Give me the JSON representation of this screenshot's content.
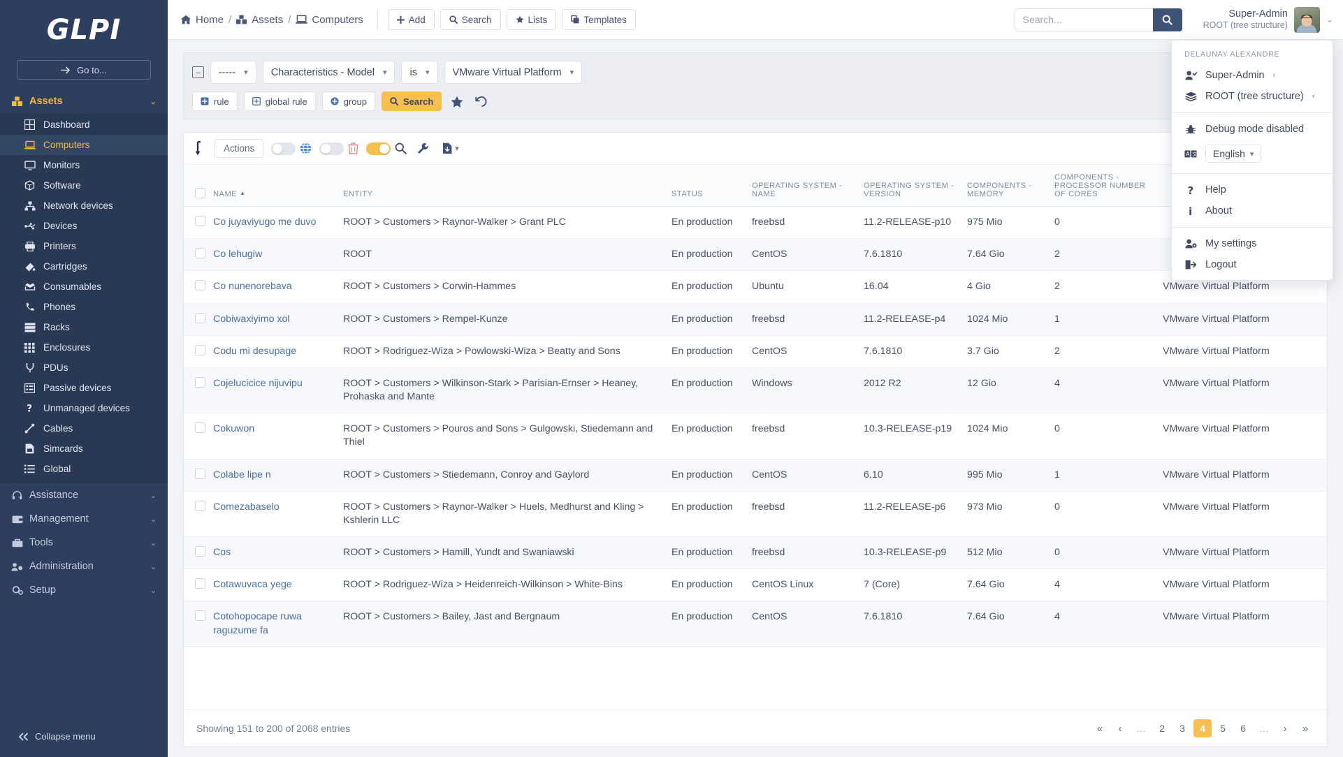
{
  "brand": {
    "logo": "GLPI",
    "goto_label": "Go to...",
    "collapse_label": "Collapse menu"
  },
  "sidebar": {
    "sections": [
      {
        "label": "Assets",
        "icon": "boxes-icon",
        "active": true
      },
      {
        "label": "Assistance",
        "icon": "headset-icon",
        "active": false
      },
      {
        "label": "Management",
        "icon": "wallet-icon",
        "active": false
      },
      {
        "label": "Tools",
        "icon": "toolbox-icon",
        "active": false
      },
      {
        "label": "Administration",
        "icon": "users-cog-icon",
        "active": false
      },
      {
        "label": "Setup",
        "icon": "cogs-icon",
        "active": false
      }
    ],
    "items": [
      {
        "label": "Dashboard",
        "icon": "grid-icon",
        "selected": false
      },
      {
        "label": "Computers",
        "icon": "laptop-icon",
        "selected": true
      },
      {
        "label": "Monitors",
        "icon": "monitor-icon",
        "selected": false
      },
      {
        "label": "Software",
        "icon": "cube-icon",
        "selected": false
      },
      {
        "label": "Network devices",
        "icon": "network-icon",
        "selected": false
      },
      {
        "label": "Devices",
        "icon": "usb-icon",
        "selected": false
      },
      {
        "label": "Printers",
        "icon": "printer-icon",
        "selected": false
      },
      {
        "label": "Cartridges",
        "icon": "cartridge-icon",
        "selected": false
      },
      {
        "label": "Consumables",
        "icon": "box-open-icon",
        "selected": false
      },
      {
        "label": "Phones",
        "icon": "phone-icon",
        "selected": false
      },
      {
        "label": "Racks",
        "icon": "server-icon",
        "selected": false
      },
      {
        "label": "Enclosures",
        "icon": "th-icon",
        "selected": false
      },
      {
        "label": "PDUs",
        "icon": "plug-icon",
        "selected": false
      },
      {
        "label": "Passive devices",
        "icon": "list-alt-icon",
        "selected": false
      },
      {
        "label": "Unmanaged devices",
        "icon": "question-icon",
        "selected": false
      },
      {
        "label": "Cables",
        "icon": "cable-icon",
        "selected": false
      },
      {
        "label": "Simcards",
        "icon": "simcard-icon",
        "selected": false
      },
      {
        "label": "Global",
        "icon": "list-icon",
        "selected": false
      }
    ]
  },
  "topbar": {
    "breadcrumb": [
      {
        "label": "Home",
        "icon": "home-icon"
      },
      {
        "label": "Assets",
        "icon": "boxes-icon"
      },
      {
        "label": "Computers",
        "icon": "laptop-icon"
      }
    ],
    "buttons": [
      {
        "label": "Add",
        "icon": "plus-icon"
      },
      {
        "label": "Search",
        "icon": "search-icon"
      },
      {
        "label": "Lists",
        "icon": "star-icon"
      },
      {
        "label": "Templates",
        "icon": "clone-icon"
      }
    ],
    "search_placeholder": "Search...",
    "user": {
      "name": "Super-Admin",
      "entity": "ROOT (tree structure)"
    }
  },
  "user_menu": {
    "header": "DELAUNAY ALEXANDRE",
    "profile": {
      "label": "Super-Admin",
      "icon": "user-check-icon",
      "arrow": "‹"
    },
    "entity": {
      "label": "ROOT (tree structure)",
      "icon": "layers-icon",
      "arrow": "‹"
    },
    "debug": {
      "label": "Debug mode disabled",
      "icon": "bug-icon"
    },
    "language": {
      "label": "English",
      "icon": "translate-icon"
    },
    "help": {
      "label": "Help",
      "icon": "question-icon"
    },
    "about": {
      "label": "About",
      "icon": "info-icon"
    },
    "settings": {
      "label": "My settings",
      "icon": "user-cog-icon"
    },
    "logout": {
      "label": "Logout",
      "icon": "signout-icon"
    }
  },
  "search_panel": {
    "logic": "-----",
    "field": "Characteristics - Model",
    "operator": "is",
    "value": "VMware Virtual Platform",
    "buttons": {
      "rule": "rule",
      "global_rule": "global rule",
      "group": "group",
      "search": "Search"
    },
    "star_icon": "star-icon",
    "reset_icon": "undo-icon"
  },
  "toolbar": {
    "actions_label": "Actions",
    "toggles": [
      {
        "name": "global-toggle",
        "icon": "globe-icon",
        "on": false
      },
      {
        "name": "delete-toggle",
        "icon": "trash-icon",
        "on": false
      },
      {
        "name": "search-toggle",
        "icon": "search-icon",
        "on": true
      }
    ],
    "wrench_icon": "wrench-icon",
    "export_icon": "file-export-icon"
  },
  "table": {
    "columns": [
      "NAME",
      "ENTITY",
      "STATUS",
      "OPERATING SYSTEM - NAME",
      "OPERATING SYSTEM - VERSION",
      "COMPONENTS - MEMORY",
      "COMPONENTS - PROCESSOR NUMBER OF CORES",
      ""
    ],
    "sort_column": "NAME",
    "sort_dir": "asc",
    "rows": [
      {
        "name": "Co juyaviyugo me duvo",
        "entity": "ROOT > Customers > Raynor-Walker > Grant PLC",
        "status": "En production",
        "os": "freebsd",
        "version": "11.2-RELEASE-p10",
        "memory": "975 Mio",
        "cores": "0",
        "model": ""
      },
      {
        "name": "Co lehugiw",
        "entity": "ROOT",
        "status": "En production",
        "os": "CentOS",
        "version": "7.6.1810",
        "memory": "7.64 Gio",
        "cores": "2",
        "model": ""
      },
      {
        "name": "Co nunenorebava",
        "entity": "ROOT > Customers > Corwin-Hammes",
        "status": "En production",
        "os": "Ubuntu",
        "version": "16.04",
        "memory": "4 Gio",
        "cores": "2",
        "model": "VMware Virtual Platform"
      },
      {
        "name": "Cobiwaxiyimo xol",
        "entity": "ROOT > Customers > Rempel-Kunze",
        "status": "En production",
        "os": "freebsd",
        "version": "11.2-RELEASE-p4",
        "memory": "1024 Mio",
        "cores": "1",
        "model": "VMware Virtual Platform"
      },
      {
        "name": "Codu mi desupage",
        "entity": "ROOT > Rodriguez-Wiza > Powlowski-Wiza > Beatty and Sons",
        "status": "En production",
        "os": "CentOS",
        "version": "7.6.1810",
        "memory": "3.7 Gio",
        "cores": "2",
        "model": "VMware Virtual Platform"
      },
      {
        "name": "Cojelucicice nijuvipu",
        "entity": "ROOT > Customers > Wilkinson-Stark > Parisian-Ernser > Heaney, Prohaska and Mante",
        "status": "En production",
        "os": "Windows",
        "version": "2012 R2",
        "memory": "12 Gio",
        "cores": "4",
        "model": "VMware Virtual Platform"
      },
      {
        "name": "Cokuwon",
        "entity": "ROOT > Customers > Pouros and Sons > Gulgowski, Stiedemann and Thiel",
        "status": "En production",
        "os": "freebsd",
        "version": "10.3-RELEASE-p19",
        "memory": "1024 Mio",
        "cores": "0",
        "model": "VMware Virtual Platform"
      },
      {
        "name": "Colabe lipe n",
        "entity": "ROOT > Customers > Stiedemann, Conroy and Gaylord",
        "status": "En production",
        "os": "CentOS",
        "version": "6.10",
        "memory": "995 Mio",
        "cores": "1",
        "model": "VMware Virtual Platform"
      },
      {
        "name": "Comezabaselo",
        "entity": "ROOT > Customers > Raynor-Walker > Huels, Medhurst and Kling > Kshlerin LLC",
        "status": "En production",
        "os": "freebsd",
        "version": "11.2-RELEASE-p6",
        "memory": "973 Mio",
        "cores": "0",
        "model": "VMware Virtual Platform"
      },
      {
        "name": "Cos",
        "entity": "ROOT > Customers > Hamill, Yundt and Swaniawski",
        "status": "En production",
        "os": "freebsd",
        "version": "10.3-RELEASE-p9",
        "memory": "512 Mio",
        "cores": "0",
        "model": "VMware Virtual Platform"
      },
      {
        "name": "Cotawuvaca yege",
        "entity": "ROOT > Rodriguez-Wiza > Heidenreich-Wilkinson > White-Bins",
        "status": "En production",
        "os": "CentOS Linux",
        "version": "7 (Core)",
        "memory": "7.64 Gio",
        "cores": "4",
        "model": "VMware Virtual Platform"
      },
      {
        "name": "Cotohopocape ruwa raguzume fa",
        "entity": "ROOT > Customers > Bailey, Jast and Bergnaum",
        "status": "En production",
        "os": "CentOS",
        "version": "7.6.1810",
        "memory": "7.64 Gio",
        "cores": "4",
        "model": "VMware Virtual Platform"
      }
    ]
  },
  "footer": {
    "showing": "Showing 151 to 200 of 2068 entries",
    "pages": [
      {
        "label": "«",
        "type": "nav"
      },
      {
        "label": "‹",
        "type": "nav"
      },
      {
        "label": "…",
        "type": "dots"
      },
      {
        "label": "2",
        "type": "page"
      },
      {
        "label": "3",
        "type": "page"
      },
      {
        "label": "4",
        "type": "active"
      },
      {
        "label": "5",
        "type": "page"
      },
      {
        "label": "6",
        "type": "page"
      },
      {
        "label": "…",
        "type": "dots"
      },
      {
        "label": "›",
        "type": "nav"
      },
      {
        "label": "»",
        "type": "nav"
      }
    ]
  },
  "colors": {
    "sidebar": "#2d3e5f",
    "accent": "#f7bf4f",
    "link": "#4a6fa8",
    "text": "#45506b"
  }
}
